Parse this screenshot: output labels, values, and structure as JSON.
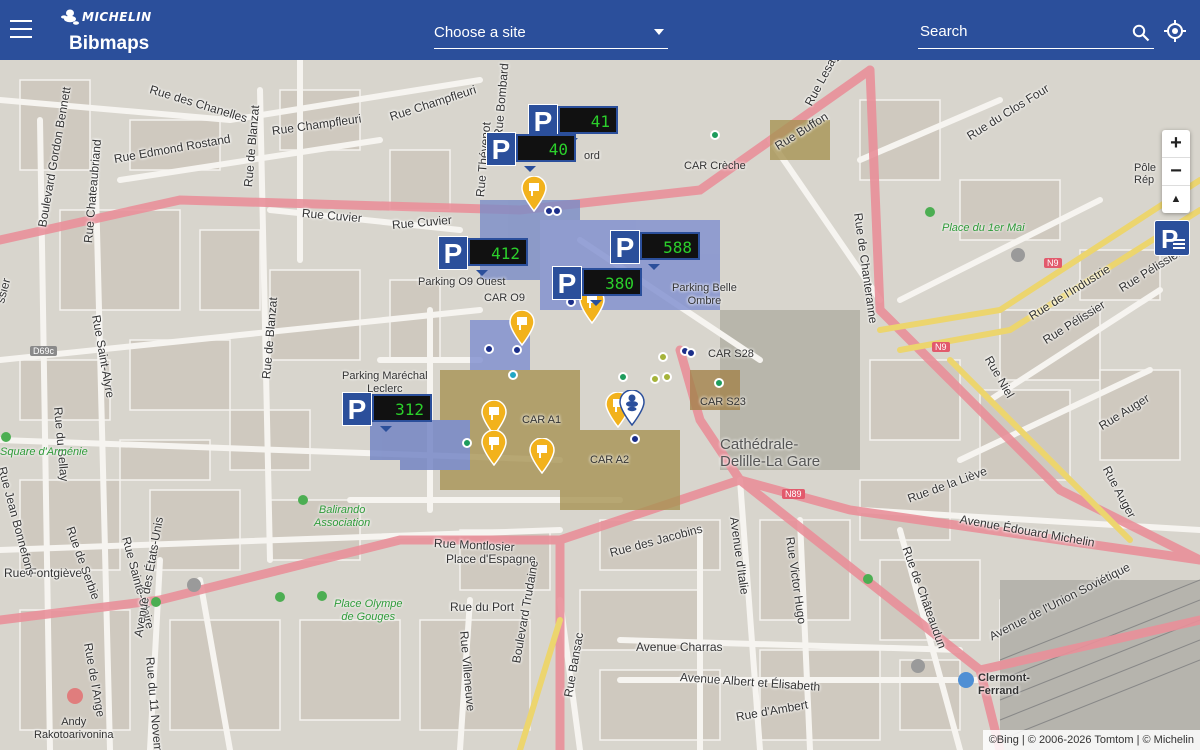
{
  "header": {
    "brand_logo": "MICHELIN",
    "app_name": "Bibmaps",
    "site_select_label": "Choose a site",
    "search_placeholder": "Search"
  },
  "colors": {
    "header_bg": "#2b4f9b",
    "parking_blue": "#2b4f9b",
    "counter_green": "#2bd02b",
    "pin_yellow": "#f2b21c",
    "road_pink": "#e98c98"
  },
  "parking_markers": [
    {
      "id": "p1",
      "count": "41"
    },
    {
      "id": "p2",
      "count": "40"
    },
    {
      "id": "p3",
      "count": "412"
    },
    {
      "id": "p4",
      "count": "588"
    },
    {
      "id": "p5",
      "count": "380"
    },
    {
      "id": "p6",
      "count": "312"
    }
  ],
  "parking_letter": "P",
  "map_labels": {
    "car_creche": "CAR Crèche",
    "parking_o9": "Parking O9 Ouest",
    "car_o9": "CAR O9",
    "parking_belle_ombre": "Parking Belle\nOmbre",
    "car_s28": "CAR S28",
    "car_s23": "CAR S23",
    "parking_marechal": "Parking Maréchal\nLeclerc",
    "car_a1": "CAR A1",
    "car_a2": "CAR A2",
    "cathedrale": "Cathédrale-\nDelille-La Gare",
    "clermont": "Clermont-\nFerrand",
    "andy": "Andy\nRakotoarivonina",
    "pole": "Pôle\nRép",
    "ford": "ord"
  },
  "green_labels": {
    "square_armenie": "Square d'Arménie",
    "balirando": "Balirando\nAssociation",
    "place_olympe": "Place Olympe\nde Gouges",
    "place_1er_mai": "Place du 1er Mai"
  },
  "streets": {
    "chanelles": "Rue des Chanelles",
    "gordon_bennett": "Boulevard Gordon Bennett",
    "chateaubriand": "Rue Chateaubriand",
    "champfleuri": "Rue Champfleuri",
    "champfleuri2": "Rue Champfleuri",
    "blanzat": "Rue de Blanzat",
    "edmond_rostand": "Rue Edmond Rostand",
    "thevenot": "Rue Thévenot",
    "bombard": "Rue Bombard",
    "cuvier1": "Rue Cuvier",
    "cuvier2": "Rue Cuvier",
    "lesage": "Rue Lesage",
    "clos_four": "Rue du Clos Four",
    "buffon": "Rue Buffon",
    "saint_alyre": "Rue Saint-Alyre",
    "du_bellay": "Rue du Bellay",
    "blanzat2": "Rue de Blanzat",
    "chanteranne": "Rue de Chanteranne",
    "industrie": "Rue de l'Industrie",
    "pelissier1": "Rue Pélissier",
    "pelissier2": "Rue Pélissier",
    "niel": "Rue Niel",
    "auger1": "Rue Auger",
    "auger2": "Rue Auger",
    "lieve": "Rue de la Liève",
    "edouard_michelin": "Avenue Édouard Michelin",
    "union_sovietique": "Avenue de l'Union Soviétique",
    "montlosier": "Rue Montlosier",
    "place_espagne": "Place d'Espagne",
    "jacobins": "Rue des Jacobins",
    "italie": "Avenue d'Italie",
    "victor_hugo": "Rue Victor Hugo",
    "chateaudun": "Rue de Châteaudun",
    "fontgieve": "Rue Fontgiève",
    "jean_bonnefons": "Rue Jean Bonnefons",
    "serbie": "Rue de Serbie",
    "sainte_claire": "Rue Sainte-Claire",
    "etats_unis": "Avenue des États-Unis",
    "onze_novembre": "Rue du 11 Novembre",
    "ange": "Rue de l'Ange",
    "port": "Rue du Port",
    "villeneuve": "Rue Villeneuve",
    "trudaine": "Boulevard Trudaine",
    "bansac": "Rue Bansac",
    "charras": "Avenue Charras",
    "albert_elisabeth": "Avenue Albert et Élisabeth",
    "ambert": "Rue d'Ambert",
    "sissier": "ssier"
  },
  "road_numbers": {
    "n9a": "N9",
    "n9b": "N9",
    "n89": "N89",
    "d69c": "D69c"
  },
  "controls": {
    "zoom_in": "+",
    "zoom_out": "−",
    "compass": "▲"
  },
  "attribution": "©Bing | © 2006-2026 Tomtom | © Michelin"
}
